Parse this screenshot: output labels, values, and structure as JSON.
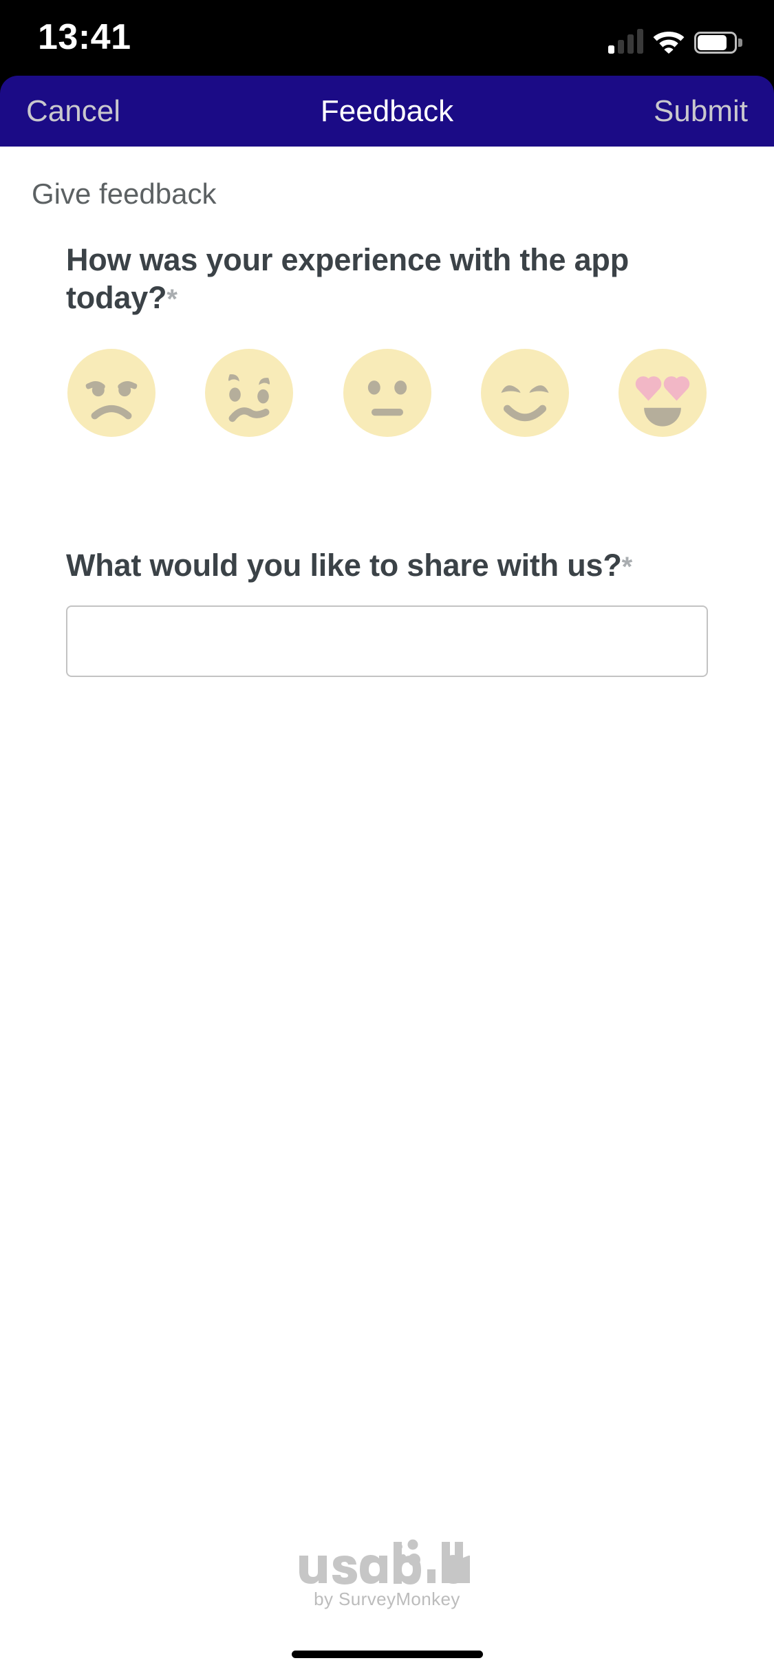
{
  "status_bar": {
    "time": "13:41",
    "cellular_icon": "cellular-signal-icon",
    "cellular_bars_total": 4,
    "cellular_bars_active": 1,
    "wifi_icon": "wifi-icon",
    "battery_icon": "battery-icon",
    "battery_level_pct": 80
  },
  "nav_bar": {
    "cancel_label": "Cancel",
    "title": "Feedback",
    "submit_label": "Submit",
    "background_color": "#1b0b86",
    "title_color": "#ffffff",
    "action_color": "#c9c8cd"
  },
  "page": {
    "section_label": "Give feedback",
    "background_color": "#ffffff"
  },
  "questions": [
    {
      "id": "mood-rating",
      "text": "How was your experience with the app today?",
      "required_marker": "*",
      "type": "mood-rating",
      "selected": null,
      "options": [
        {
          "value": 1,
          "icon": "emoji-angry-icon",
          "label": "Angry"
        },
        {
          "value": 2,
          "icon": "emoji-sad-icon",
          "label": "Sad"
        },
        {
          "value": 3,
          "icon": "emoji-neutral-icon",
          "label": "Neutral"
        },
        {
          "value": 4,
          "icon": "emoji-happy-icon",
          "label": "Happy"
        },
        {
          "value": 5,
          "icon": "emoji-heart-eyes-icon",
          "label": "Love it"
        }
      ]
    },
    {
      "id": "open-comment",
      "text": "What would you like to share with us?",
      "required_marker": "*",
      "type": "text",
      "value": "",
      "placeholder": ""
    }
  ],
  "colors": {
    "emoji_face": "#f8ebb8",
    "emoji_feature": "#b5ae9b",
    "emoji_heart": "#f2b7c6",
    "question_text": "#3b4247",
    "required_marker": "#a9adb0",
    "input_border": "#c3c3c3",
    "footer_text": "#bcbcbc"
  },
  "footer": {
    "logo_wordmark": "usabilla",
    "logo_icon": "usabilla-logo-icon",
    "byline": "by SurveyMonkey"
  },
  "home_indicator": {
    "icon": "home-indicator-bar"
  }
}
